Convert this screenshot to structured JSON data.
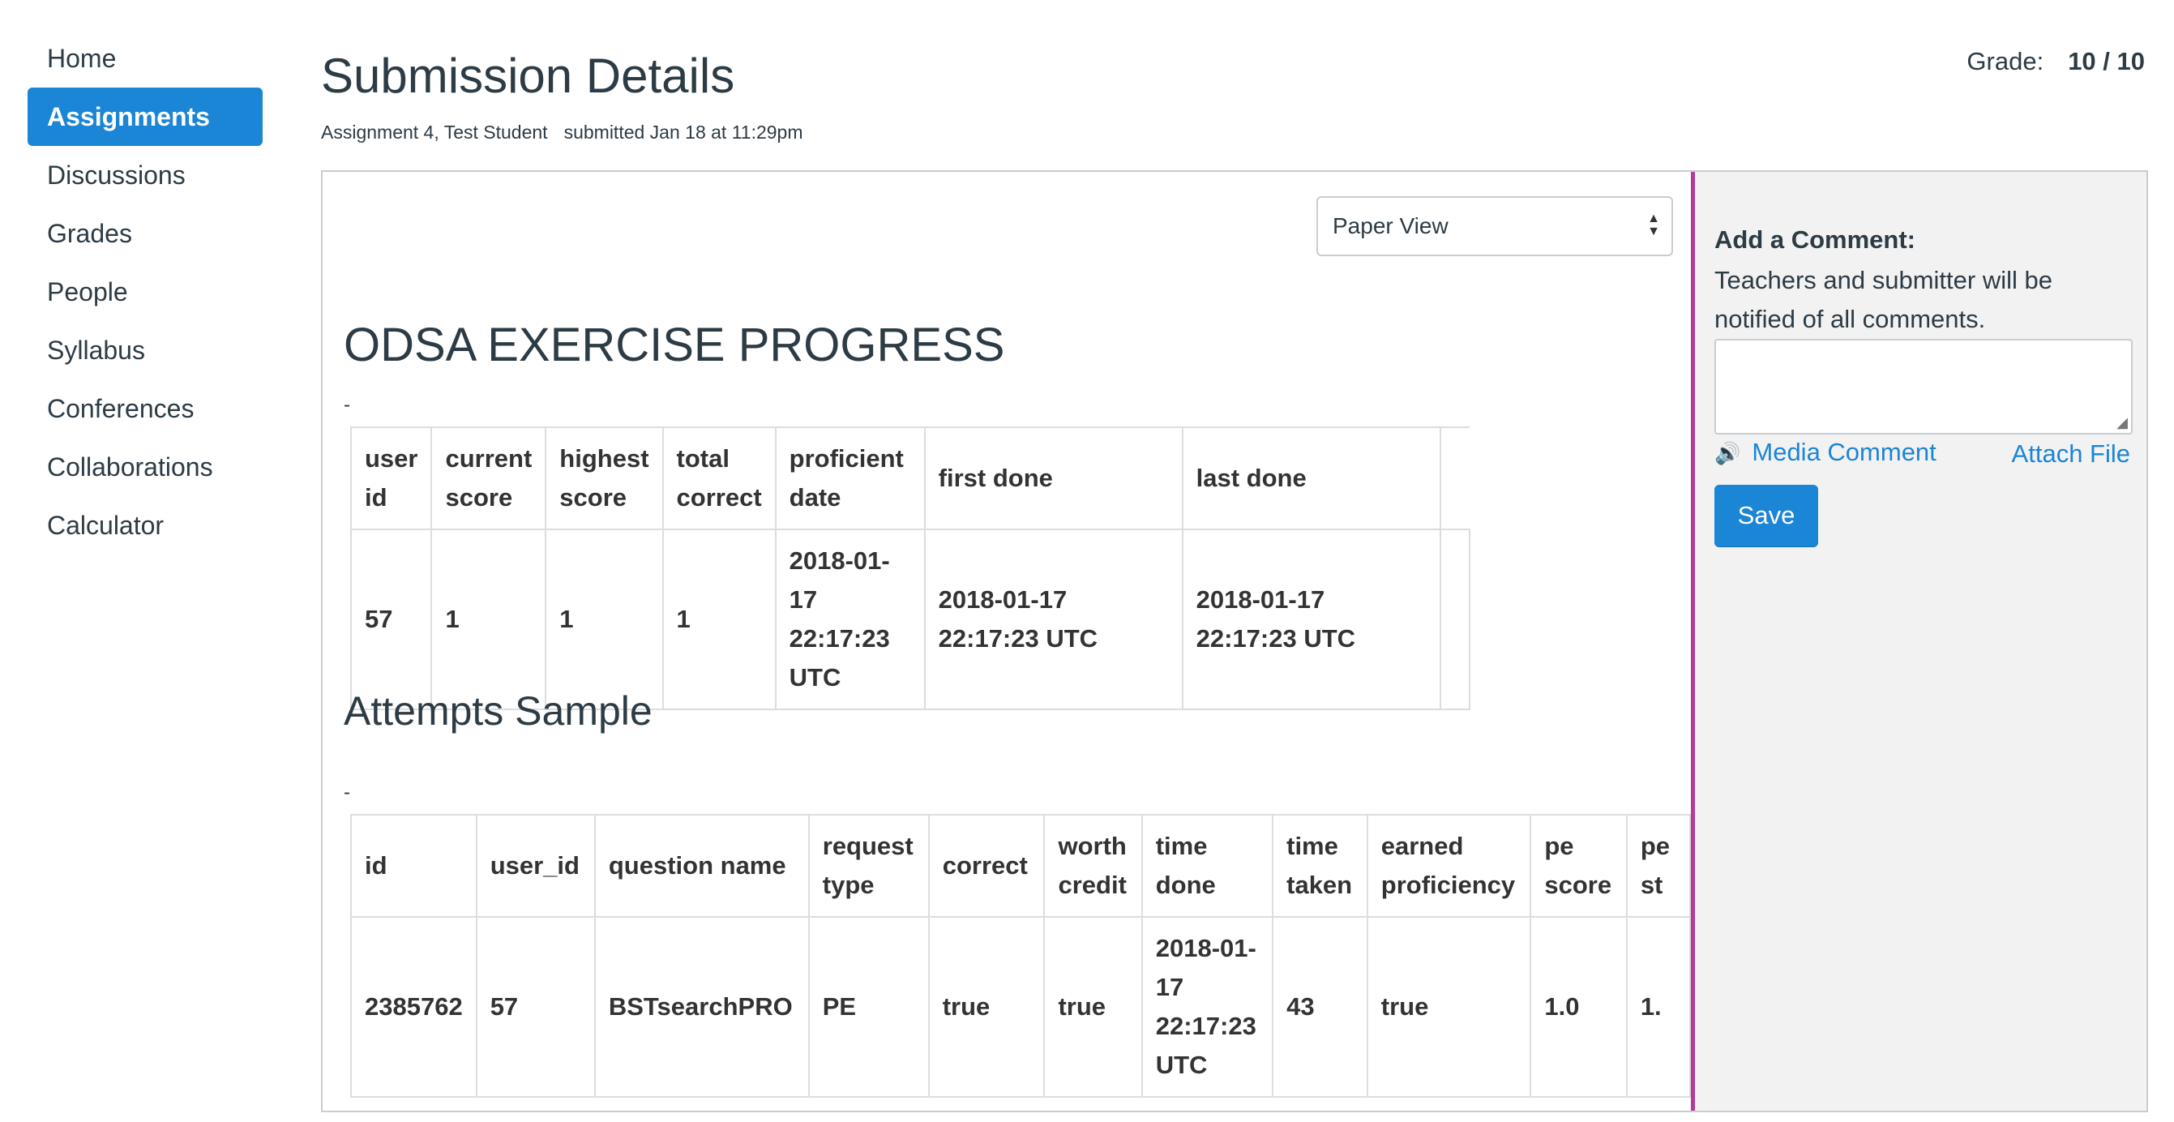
{
  "nav": {
    "items": [
      {
        "label": "Home"
      },
      {
        "label": "Assignments",
        "active": true
      },
      {
        "label": "Discussions"
      },
      {
        "label": "Grades"
      },
      {
        "label": "People"
      },
      {
        "label": "Syllabus"
      },
      {
        "label": "Conferences"
      },
      {
        "label": "Collaborations"
      },
      {
        "label": "Calculator"
      }
    ]
  },
  "header": {
    "title": "Submission Details",
    "assignment_student": "Assignment 4, Test Student",
    "submitted": "submitted Jan 18 at 11:29pm",
    "grade_label": "Grade:",
    "grade_value": "10 / 10"
  },
  "document": {
    "view_select": {
      "selected": "Paper View",
      "arrows_icon": "updown-arrows-icon"
    },
    "progress_heading": "ODSA EXERCISE PROGRESS",
    "dash": "-",
    "progress_table": {
      "headers": [
        "user id",
        "current score",
        "highest score",
        "total correct",
        "proficient date",
        "first done",
        "last done"
      ],
      "rows": [
        [
          "57",
          "1",
          "1",
          "1",
          "2018-01-17 22:17:23 UTC",
          "2018-01-17 22:17:23 UTC",
          "2018-01-17 22:17:23 UTC"
        ]
      ]
    },
    "attempts_heading": "Attempts Sample",
    "attempts_table": {
      "headers": [
        "id",
        "user_id",
        "question name",
        "request type",
        "correct",
        "worth credit",
        "time done",
        "time taken",
        "earned proficiency",
        "pe score",
        "pe st"
      ],
      "rows": [
        [
          "2385762",
          "57",
          "BSTsearchPRO",
          "PE",
          "true",
          "true",
          "2018-01-17 22:17:23 UTC",
          "43",
          "true",
          "1.0",
          "1."
        ]
      ]
    }
  },
  "comments": {
    "title": "Add a Comment:",
    "note": "Teachers and submitter will be notified of all comments.",
    "textarea_value": "",
    "media_icon": "speaker-icon",
    "media_label": "Media Comment",
    "attach_label": "Attach File",
    "save_label": "Save"
  },
  "colors": {
    "accent": "#1b85d6",
    "divider": "#b53a9a",
    "sidebar_bg": "#f2f2f2",
    "text": "#2d3b45"
  }
}
